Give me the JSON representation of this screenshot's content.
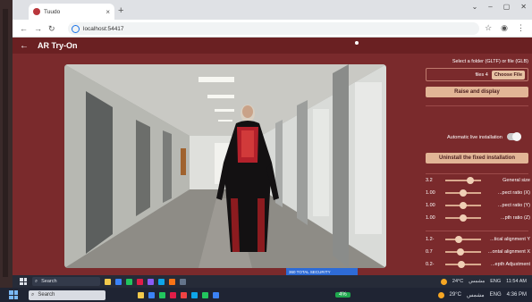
{
  "browser": {
    "tab_title": "Tuudo",
    "url": "localhost:54417"
  },
  "app": {
    "title": "AR Try-On"
  },
  "panel": {
    "folder_label": "Select a folder (GLTF) or file (GLB)",
    "files_count": "files 4",
    "choose_file": "Choose File",
    "raise_button": "Raise and display",
    "auto_install_label": "Automatic live installation",
    "uninstall_button": "Uninstall the fixed installation",
    "sliders_size": [
      {
        "value": "3.2",
        "label": "General size",
        "level": 0.75
      },
      {
        "value": "1.00",
        "label": "...pect ratio (X)",
        "level": 0.5
      },
      {
        "value": "1.00",
        "label": "...pect ratio (Y)",
        "level": 0.5
      },
      {
        "value": "1.00",
        "label": "...pth ratio (Z)",
        "level": 0.5
      }
    ],
    "sliders_align": [
      {
        "value": "1.2-",
        "label": "...tical alignment Y",
        "level": 0.35
      },
      {
        "value": "0.7",
        "label": "...ontal alignment X",
        "level": 0.4
      },
      {
        "value": "0.2-",
        "label": "...epth Adjustment",
        "level": 0.45
      }
    ]
  },
  "inner_taskbar": {
    "search": "Search",
    "notification": "360 TOTAL SECURITY",
    "weather": "24°C",
    "weather_desc": "مشمس",
    "lang": "ENG",
    "time": "11:54 AM"
  },
  "outer_taskbar": {
    "search": "Search",
    "battery": "4%",
    "weather": "29°C",
    "weather_desc": "مشمس",
    "lang": "ENG",
    "time": "4:36 PM"
  },
  "colors": {
    "app_bg": "#7a2a2c",
    "appbar": "#6a2022",
    "button": "#e2b596"
  }
}
